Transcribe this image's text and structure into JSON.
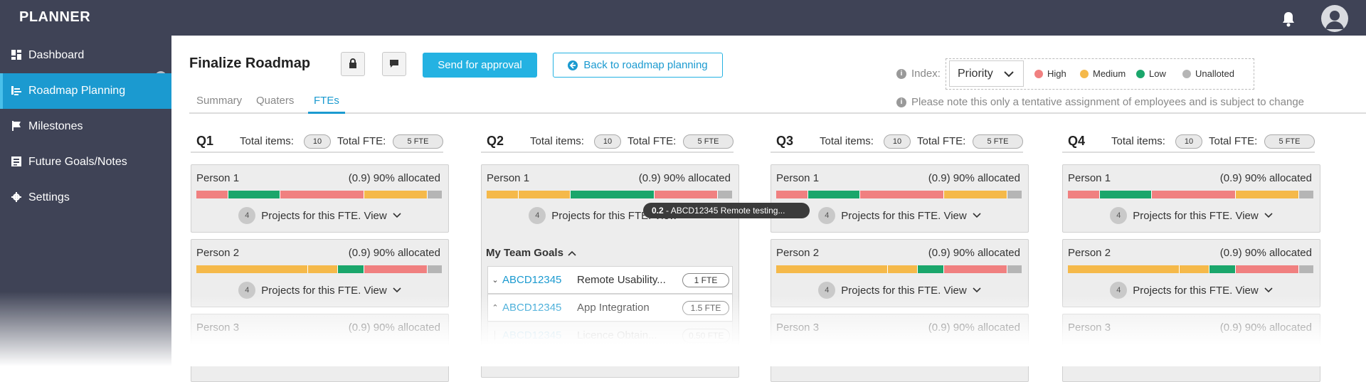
{
  "app": {
    "name": "PLANNER"
  },
  "sidebar": {
    "items": [
      {
        "label": "Dashboard",
        "icon": "dashboard-icon"
      },
      {
        "label": "Roadmap Planning",
        "icon": "list-icon",
        "active": true
      },
      {
        "label": "Milestones",
        "icon": "flag-icon"
      },
      {
        "label": "Future Goals/Notes",
        "icon": "notes-icon"
      },
      {
        "label": "Settings",
        "icon": "gear-icon"
      }
    ]
  },
  "page": {
    "title": "Finalize Roadmap",
    "send_label": "Send for approval",
    "back_label": "Back to roadmap planning",
    "tabs": [
      "Summary",
      "Quaters",
      "FTEs"
    ],
    "active_tab": "FTEs",
    "index_label": "Index:",
    "priority_value": "Priority",
    "legend": [
      {
        "label": "High",
        "color": "#f08080"
      },
      {
        "label": "Medium",
        "color": "#f5b94a"
      },
      {
        "label": "Low",
        "color": "#1aa66b"
      },
      {
        "label": "Unalloted",
        "color": "#b5b5b5"
      }
    ],
    "note": "Please note this only a tentative assignment of employees and is subject to change"
  },
  "colors": {
    "high": "#f08080",
    "medium": "#f5b94a",
    "low": "#1aa66b",
    "unalloted": "#b5b5b5",
    "accent": "#1b9ad0"
  },
  "quarters": [
    {
      "name": "Q1",
      "total_items_label": "Total items:",
      "total_items": "10",
      "total_fte_label": "Total FTE:",
      "total_fte": "5 FTE"
    },
    {
      "name": "Q2",
      "total_items_label": "Total items:",
      "total_items": "10",
      "total_fte_label": "Total FTE:",
      "total_fte": "5 FTE"
    },
    {
      "name": "Q3",
      "total_items_label": "Total items:",
      "total_items": "10",
      "total_fte_label": "Total FTE:",
      "total_fte": "5 FTE"
    },
    {
      "name": "Q4",
      "total_items_label": "Total items:",
      "total_items": "10",
      "total_fte_label": "Total FTE:",
      "total_fte": "5 FTE"
    }
  ],
  "persons": [
    {
      "name": "Person 1",
      "allocation": "(0.9) 90% allocated",
      "projects_count": "4",
      "projects_label": "Projects for this FTE. View",
      "segments": [
        {
          "p": "high",
          "v": 0.11
        },
        {
          "p": "low",
          "v": 0.18
        },
        {
          "p": "high",
          "v": 0.29
        },
        {
          "p": "medium",
          "v": 0.22
        },
        {
          "p": "unalloted",
          "v": 0.05
        }
      ]
    },
    {
      "name": "Person 2",
      "allocation": "(0.9) 90% allocated",
      "projects_count": "4",
      "projects_label": "Projects for this FTE. View",
      "segments": [
        {
          "p": "medium",
          "v": 0.39
        },
        {
          "p": "medium",
          "v": 0.1
        },
        {
          "p": "low",
          "v": 0.09
        },
        {
          "p": "high",
          "v": 0.22
        },
        {
          "p": "unalloted",
          "v": 0.05
        }
      ]
    },
    {
      "name": "Person 3",
      "allocation": "(0.9) 90% allocated"
    }
  ],
  "q2_person1": {
    "segments": [
      {
        "p": "medium",
        "v": 0.11
      },
      {
        "p": "medium",
        "v": 0.18
      },
      {
        "p": "low",
        "v": 0.29
      },
      {
        "p": "high",
        "v": 0.22
      },
      {
        "p": "unalloted",
        "v": 0.05
      }
    ]
  },
  "tooltip": {
    "value": "0.2",
    "text": " - ABCD12345 Remote testing..."
  },
  "team_goals": {
    "title": "My Team Goals",
    "rows": [
      {
        "id": "ABCD12345",
        "name": "Remote Usability...",
        "fte": "1 FTE",
        "state": "collapsed"
      },
      {
        "id": "ABCD12345",
        "name": "App Integration",
        "fte": "1.5 FTE",
        "state": "expanded"
      },
      {
        "id": "ABCD12345",
        "name": "Licence Obtain...",
        "fte": "0.50 FTE",
        "state": "child"
      }
    ]
  }
}
